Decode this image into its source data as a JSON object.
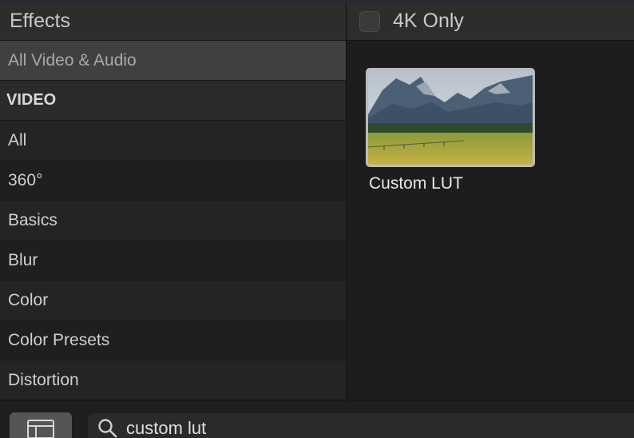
{
  "sidebar": {
    "title": "Effects",
    "items": [
      {
        "label": "All Video & Audio",
        "kind": "selected"
      },
      {
        "label": "VIDEO",
        "kind": "section"
      },
      {
        "label": "All",
        "kind": "item"
      },
      {
        "label": "360°",
        "kind": "item"
      },
      {
        "label": "Basics",
        "kind": "item"
      },
      {
        "label": "Blur",
        "kind": "item"
      },
      {
        "label": "Color",
        "kind": "item"
      },
      {
        "label": "Color Presets",
        "kind": "item"
      },
      {
        "label": "Distortion",
        "kind": "item"
      }
    ]
  },
  "filter": {
    "checkbox_label": "4K Only",
    "checked": false
  },
  "results": [
    {
      "name": "Custom LUT",
      "thumbnail": "mountain-landscape"
    }
  ],
  "search": {
    "value": "custom lut",
    "icon": "search-icon"
  },
  "bottom_bar": {
    "toggle_icon": "sidebar-toggle-icon"
  },
  "colors": {
    "background": "#1e1e1e",
    "header": "#2d2d2d",
    "selected_row": "#404040",
    "text": "#d0d0d0"
  }
}
